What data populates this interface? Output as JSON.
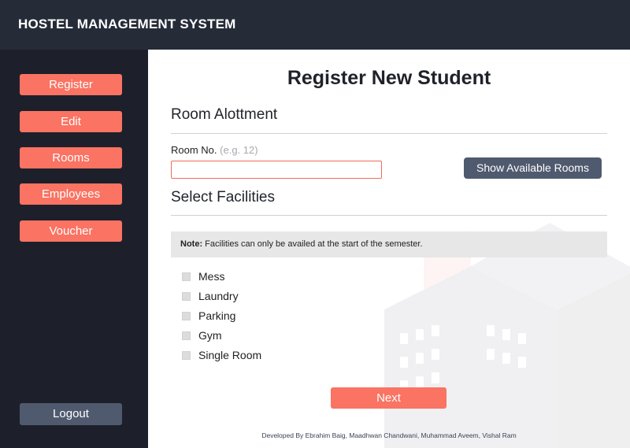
{
  "header": {
    "title": "HOSTEL MANAGEMENT SYSTEM"
  },
  "sidebar": {
    "items": [
      {
        "label": "Register"
      },
      {
        "label": "Edit"
      },
      {
        "label": "Rooms"
      },
      {
        "label": "Employees"
      },
      {
        "label": "Voucher"
      }
    ],
    "logout_label": "Logout"
  },
  "main": {
    "title": "Register New Student",
    "room_section": {
      "title": "Room Alottment",
      "room_label": "Room No.",
      "room_hint": "(e.g. 12)",
      "room_value": "",
      "show_rooms_label": "Show Available Rooms"
    },
    "facilities_section": {
      "title": "Select Facilities",
      "note_bold": "Note:",
      "note_text": "Facilities can only be availed at the start of the semester.",
      "options": [
        {
          "label": "Mess",
          "checked": false
        },
        {
          "label": "Laundry",
          "checked": false
        },
        {
          "label": "Parking",
          "checked": false
        },
        {
          "label": "Gym",
          "checked": false
        },
        {
          "label": "Single Room",
          "checked": false
        }
      ]
    },
    "next_label": "Next",
    "footer": "Developed By Ebrahim Baig, Maadhwan Chandwani, Muhammad Aveem, Vishal Ram"
  }
}
